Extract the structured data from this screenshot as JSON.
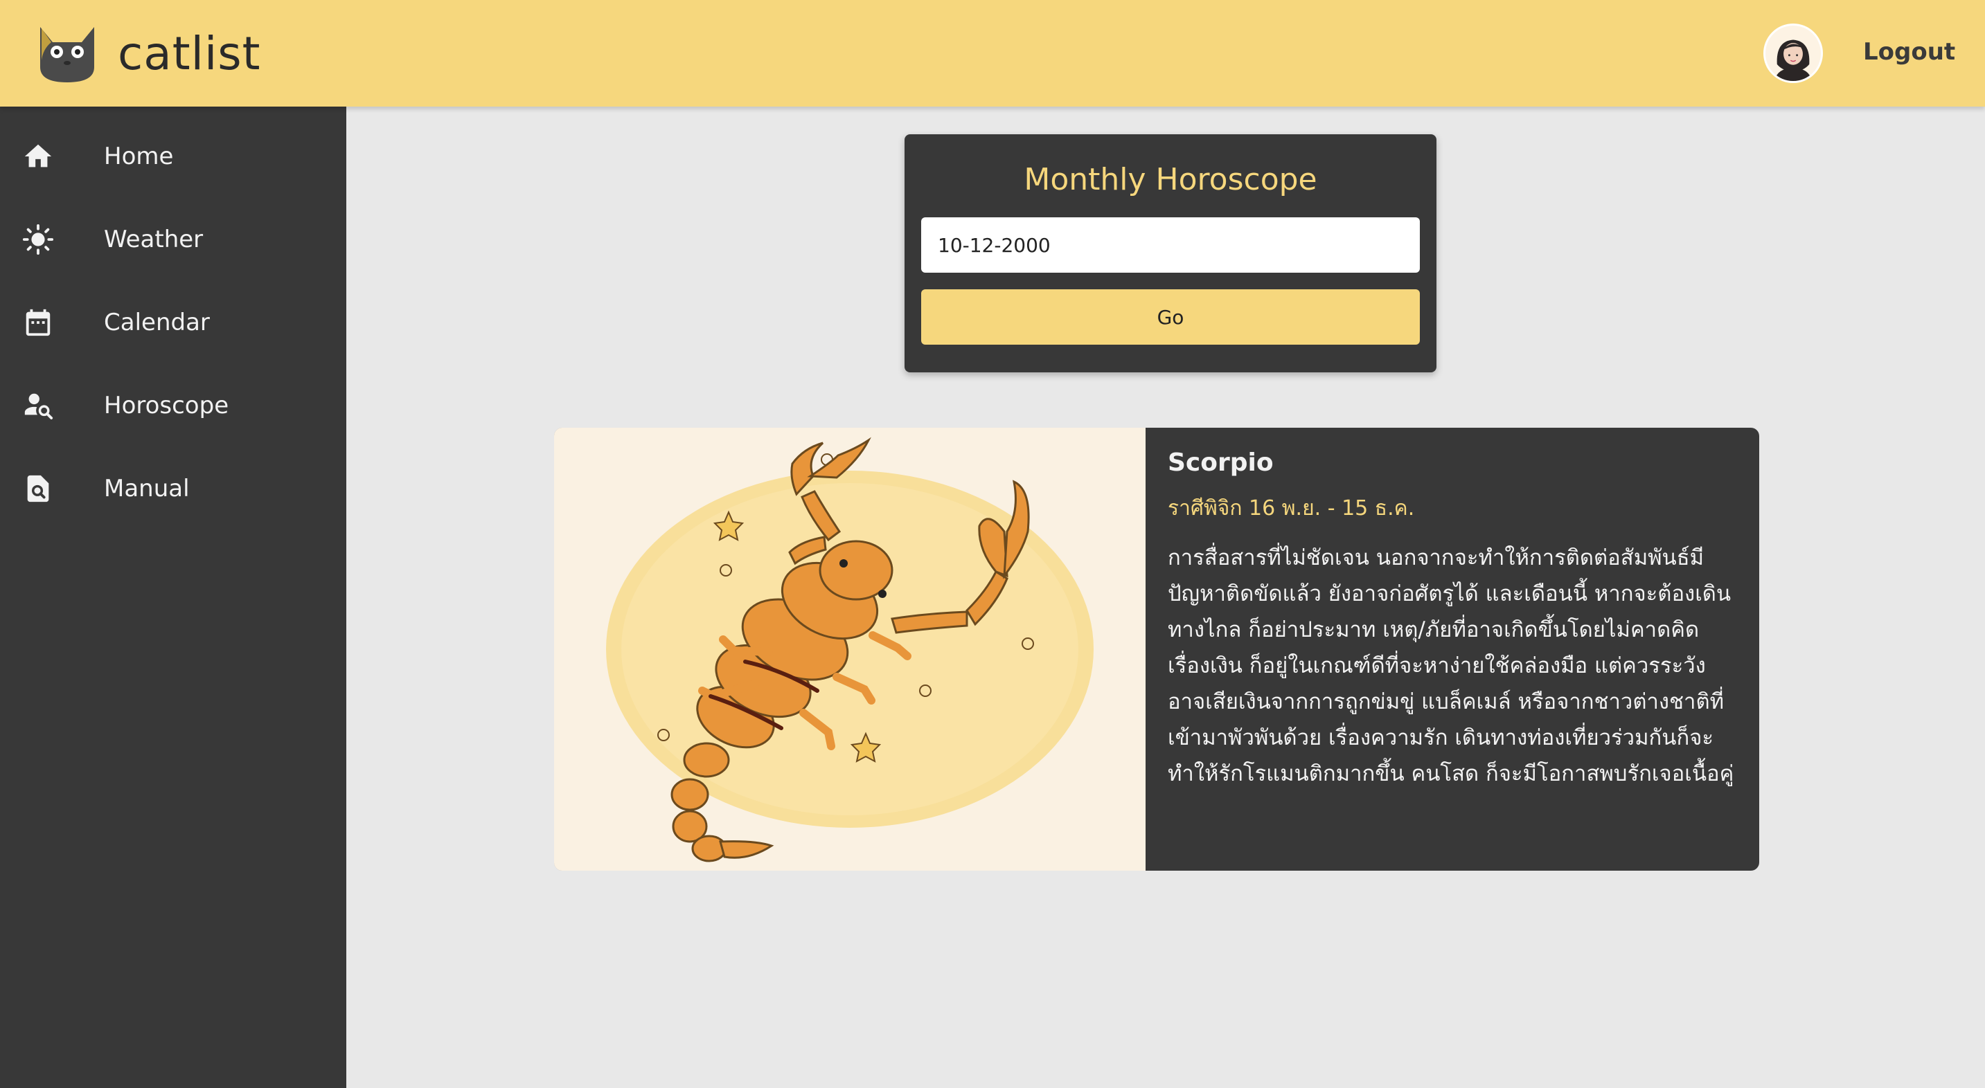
{
  "app": {
    "title": "catlist"
  },
  "header": {
    "logout_label": "Logout"
  },
  "sidebar": {
    "items": [
      {
        "label": "Home",
        "icon": "home-icon"
      },
      {
        "label": "Weather",
        "icon": "sun-icon"
      },
      {
        "label": "Calendar",
        "icon": "calendar-icon"
      },
      {
        "label": "Horoscope",
        "icon": "user-search-icon"
      },
      {
        "label": "Manual",
        "icon": "document-search-icon"
      }
    ]
  },
  "form": {
    "title": "Monthly Horoscope",
    "date_value": "10-12-2000",
    "go_label": "Go"
  },
  "result": {
    "sign_name": "Scorpio",
    "thai_range": "ราศีพิจิก 16 พ.ย. - 15 ธ.ค.",
    "description": "การสื่อสารที่ไม่ชัดเจน นอกจากจะทำให้การติดต่อสัมพันธ์มีปัญหาติดขัดแล้ว ยังอาจก่อศัตรูได้ และเดือนนี้ หากจะต้องเดินทางไกล ก็อย่าประมาท เหตุ/ภัยที่อาจเกิดขึ้นโดยไม่คาดคิด เรื่องเงิน ก็อยู่ในเกณฑ์ดีที่จะหาง่ายใช้คล่องมือ แต่ควรระวังอาจเสียเงินจากการถูกข่มขู่ แบล็คเมล์ หรือจากชาวต่างชาติที่เข้ามาพัวพันด้วย เรื่องความรัก เดินทางท่องเที่ยวร่วมกันก็จะทำให้รักโรแมนติกมากขึ้น คนโสด ก็จะมีโอกาสพบรักเจอเนื้อคู่"
  },
  "colors": {
    "accent": "#f6d77d",
    "dark": "#383838",
    "background": "#e8e8e8"
  }
}
